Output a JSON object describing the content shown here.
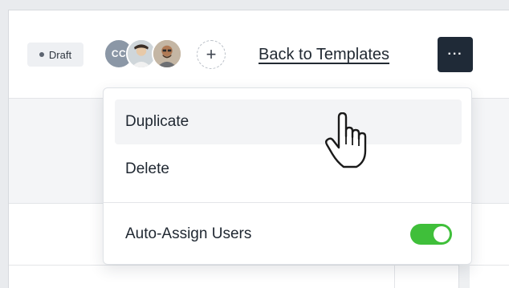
{
  "header": {
    "status_badge": "Draft",
    "avatars": [
      {
        "initials": "CC"
      },
      {
        "icon": "user-photo-icon"
      },
      {
        "icon": "user-photo-icon"
      }
    ],
    "add_user_symbol": "+",
    "back_link": "Back to Templates",
    "more_symbol": "···"
  },
  "menu": {
    "items": [
      {
        "label": "Duplicate"
      },
      {
        "label": "Delete"
      }
    ],
    "toggle": {
      "label": "Auto-Assign Users",
      "on": true
    }
  },
  "colors": {
    "toggle_on": "#3fbf3a",
    "more_button": "#1f2a37",
    "initials_avatar": "#8b97a6"
  }
}
